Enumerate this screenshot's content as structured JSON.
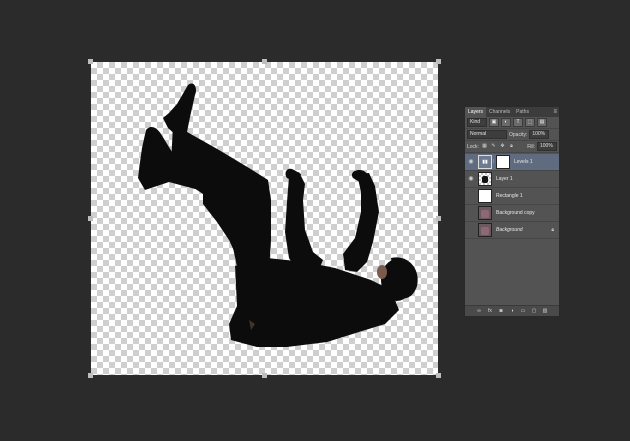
{
  "panel": {
    "tabs": [
      "Layers",
      "Channels",
      "Paths"
    ],
    "menu_icon": "panel-menu-icon",
    "filter": {
      "label": "Kind",
      "icons": [
        "image-filter-icon",
        "adjustment-filter-icon",
        "type-filter-icon",
        "shape-filter-icon",
        "smart-object-filter-icon"
      ]
    },
    "blend_mode": "Normal",
    "opacity_label": "Opacity:",
    "opacity_value": "100%",
    "lock_label": "Lock:",
    "fill_label": "Fill:",
    "fill_value": "100%"
  },
  "layers": [
    {
      "name": "Levels 1",
      "visible": true,
      "selected": true,
      "type": "adjustment"
    },
    {
      "name": "Layer 1",
      "visible": true,
      "selected": false,
      "type": "figure"
    },
    {
      "name": "Rectangle 1",
      "visible": false,
      "selected": false,
      "type": "shape"
    },
    {
      "name": "Background copy",
      "visible": false,
      "selected": false,
      "type": "photo"
    },
    {
      "name": "Background",
      "visible": false,
      "selected": false,
      "type": "photo",
      "locked": true
    }
  ],
  "footer_icons": [
    "link-layers-icon",
    "fx-icon",
    "add-mask-icon",
    "adjustment-layer-icon",
    "new-group-icon",
    "new-layer-icon",
    "trash-icon"
  ],
  "colors": {
    "app_bg": "#2b2b2b",
    "panel_bg": "#535353",
    "selected_layer": "#5f6b7e"
  }
}
